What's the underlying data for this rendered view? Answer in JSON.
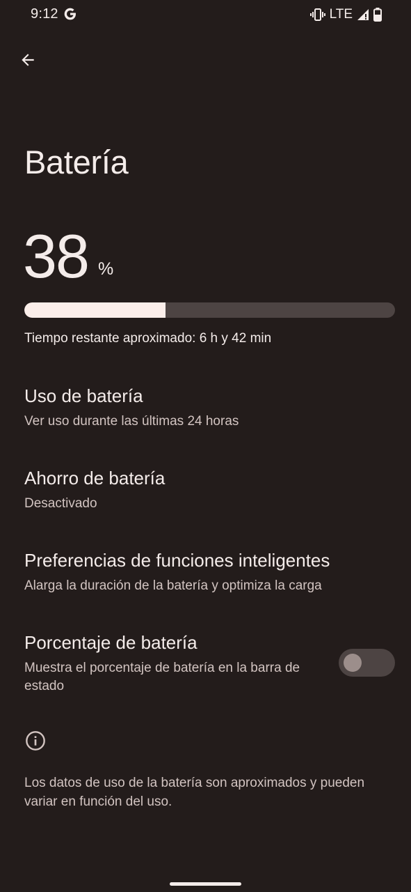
{
  "status_bar": {
    "time": "9:12",
    "network": "LTE",
    "icons": [
      "google-g-icon",
      "vibrate-icon",
      "signal-icon",
      "battery-icon"
    ]
  },
  "header": {
    "title": "Batería"
  },
  "battery": {
    "level": "38",
    "unit": "%",
    "level_fraction": 0.38,
    "remaining_text": "Tiempo restante aproximado: 6 h y 42 min"
  },
  "settings": [
    {
      "title": "Uso de batería",
      "subtitle": "Ver uso durante las últimas 24 horas"
    },
    {
      "title": "Ahorro de batería",
      "subtitle": "Desactivado"
    },
    {
      "title": "Preferencias de funciones inteligentes",
      "subtitle": "Alarga la duración de la batería y optimiza la carga"
    },
    {
      "title": "Porcentaje de batería",
      "subtitle": "Muestra el porcentaje de batería en la barra de estado",
      "toggle_on": false
    }
  ],
  "footer": {
    "note": "Los datos de uso de la batería son aproximados y pueden variar en función del uso."
  },
  "colors": {
    "background": "#231c1b",
    "text": "#f4ecea",
    "secondary_text": "#d2c4c1",
    "bar_fill": "#fbeeea",
    "bar_track": "#4d4443"
  }
}
